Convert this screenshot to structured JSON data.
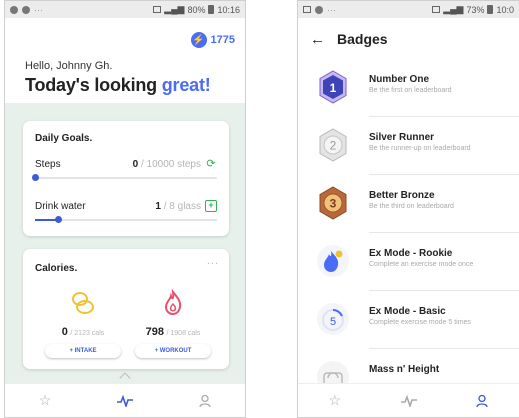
{
  "left": {
    "status": {
      "battery": "80%",
      "time": "10:16"
    },
    "points": "1775",
    "greeting": "Hello, Johnny Gh.",
    "headline_start": "Today's looking ",
    "headline_accent": "great!",
    "goals": {
      "title": "Daily Goals.",
      "steps": {
        "label": "Steps",
        "value": "0",
        "target": "/ 10000 steps",
        "progress": 0
      },
      "water": {
        "label": "Drink water",
        "value": "1",
        "target": "/ 8 glass",
        "progress": 0.125
      }
    },
    "calories": {
      "title": "Calories.",
      "more": "...",
      "intake": {
        "value": "0",
        "target": "/ 2123 cals",
        "button": "+ INTAKE"
      },
      "workout": {
        "value": "798",
        "target": "/ 1908 cals",
        "button": "+ WORKOUT"
      }
    }
  },
  "right": {
    "status": {
      "battery": "73%",
      "time": "10:0"
    },
    "title": "Badges",
    "badges": [
      {
        "title": "Number One",
        "subtitle": "Be the first on leaderboard"
      },
      {
        "title": "Silver Runner",
        "subtitle": "Be the runner-up on leaderboard"
      },
      {
        "title": "Better Bronze",
        "subtitle": "Be the third on leaderboard"
      },
      {
        "title": "Ex Mode - Rookie",
        "subtitle": "Complete an exercise mode once"
      },
      {
        "title": "Ex Mode - Basic",
        "subtitle": "Complete exercise mode 5 times"
      },
      {
        "title": "Mass n' Height",
        "subtitle": ""
      }
    ],
    "badge_numbers": [
      "1",
      "2",
      "3",
      "5"
    ]
  },
  "colors": {
    "accent": "#4a6cf7",
    "green": "#31b05b",
    "card_bg": "#e7f0eb"
  }
}
